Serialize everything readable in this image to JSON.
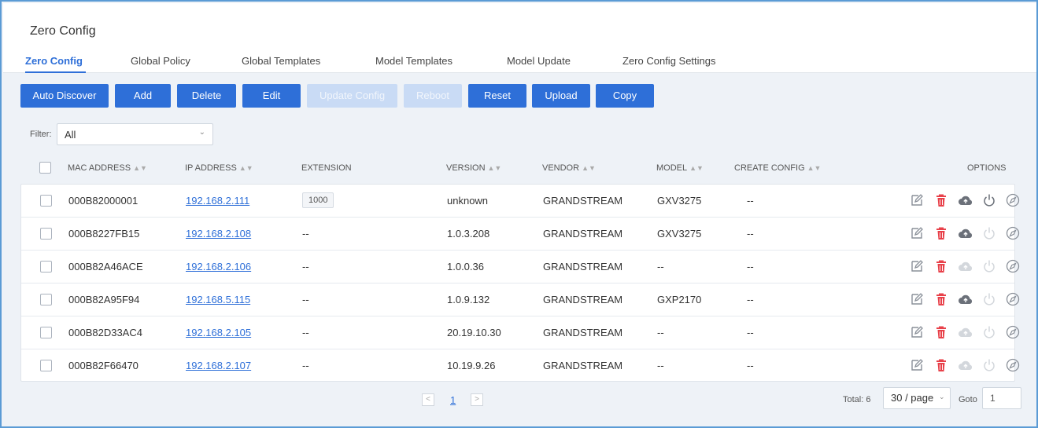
{
  "page": {
    "title": "Zero Config"
  },
  "tabs": [
    {
      "label": "Zero Config",
      "active": true
    },
    {
      "label": "Global Policy",
      "active": false
    },
    {
      "label": "Global Templates",
      "active": false
    },
    {
      "label": "Model Templates",
      "active": false
    },
    {
      "label": "Model Update",
      "active": false
    },
    {
      "label": "Zero Config Settings",
      "active": false
    }
  ],
  "toolbar": {
    "auto_discover": "Auto Discover",
    "add": "Add",
    "delete": "Delete",
    "edit": "Edit",
    "update_config": "Update Config",
    "reboot": "Reboot",
    "reset": "Reset",
    "upload": "Upload",
    "copy": "Copy"
  },
  "filter": {
    "label": "Filter:",
    "value": "All"
  },
  "columns": {
    "mac": "MAC ADDRESS",
    "ip": "IP ADDRESS",
    "extension": "EXTENSION",
    "version": "VERSION",
    "vendor": "VENDOR",
    "model": "MODEL",
    "create_config": "CREATE CONFIG",
    "options": "OPTIONS"
  },
  "rows": [
    {
      "mac": "000B82000001",
      "ip": "192.168.2.111",
      "extension": "1000",
      "version": "unknown",
      "vendor": "GRANDSTREAM",
      "model": "GXV3275",
      "create_config": "--",
      "upload_enabled": true,
      "reboot_enabled": true
    },
    {
      "mac": "000B8227FB15",
      "ip": "192.168.2.108",
      "extension": "--",
      "version": "1.0.3.208",
      "vendor": "GRANDSTREAM",
      "model": "GXV3275",
      "create_config": "--",
      "upload_enabled": true,
      "reboot_enabled": false
    },
    {
      "mac": "000B82A46ACE",
      "ip": "192.168.2.106",
      "extension": "--",
      "version": "1.0.0.36",
      "vendor": "GRANDSTREAM",
      "model": "--",
      "create_config": "--",
      "upload_enabled": false,
      "reboot_enabled": false
    },
    {
      "mac": "000B82A95F94",
      "ip": "192.168.5.115",
      "extension": "--",
      "version": "1.0.9.132",
      "vendor": "GRANDSTREAM",
      "model": "GXP2170",
      "create_config": "--",
      "upload_enabled": true,
      "reboot_enabled": false
    },
    {
      "mac": "000B82D33AC4",
      "ip": "192.168.2.105",
      "extension": "--",
      "version": "20.19.10.30",
      "vendor": "GRANDSTREAM",
      "model": "--",
      "create_config": "--",
      "upload_enabled": false,
      "reboot_enabled": false
    },
    {
      "mac": "000B82F66470",
      "ip": "192.168.2.107",
      "extension": "--",
      "version": "10.19.9.26",
      "vendor": "GRANDSTREAM",
      "model": "--",
      "create_config": "--",
      "upload_enabled": false,
      "reboot_enabled": false
    }
  ],
  "pagination": {
    "prev": "<",
    "page": "1",
    "next": ">",
    "total": "Total: 6",
    "per_page": "30 / page",
    "goto_label": "Goto",
    "goto_value": "1"
  },
  "colors": {
    "primary": "#2e6fd8",
    "disabled_button": "#c9dbf5",
    "delete_icon": "#e8414a",
    "icon_gray": "#8a9099",
    "icon_disabled": "#d3d7dc"
  },
  "icons": [
    "edit-icon",
    "delete-icon",
    "cloud-upload-icon",
    "power-icon",
    "compass-icon",
    "sort-icon",
    "chevron-down-icon"
  ]
}
